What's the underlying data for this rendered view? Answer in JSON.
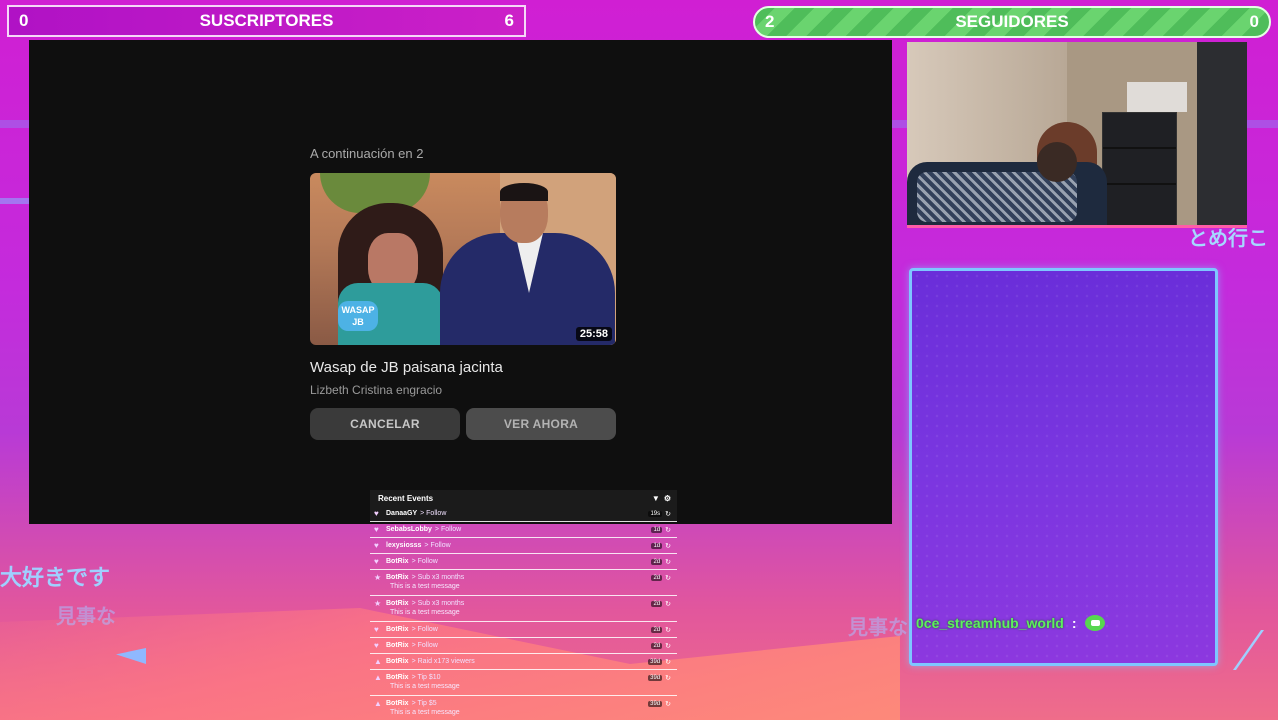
{
  "top_bars": {
    "subs": {
      "left_count": "0",
      "label": "SUSCRIPTORES",
      "right_count": "6"
    },
    "followers": {
      "left_count": "2",
      "label": "SEGUIDORES",
      "right_count": "0"
    }
  },
  "player": {
    "up_next_label": "A continuación en 2",
    "thumbnail_logo": "WASAP JB",
    "thumbnail_caption": "",
    "duration": "25:58",
    "video_title": "Wasap de JB paisana jacinta",
    "channel_name": "Lizbeth Cristina engracio",
    "cancel_label": "CANCELAR",
    "watch_label": "VER AHORA"
  },
  "decor_text": {
    "jp_left_1": "大好きです",
    "jp_left_2": "見事な",
    "jp_right_1": "とめ行こ",
    "jp_right_2": "見事な"
  },
  "chat": {
    "messages": [
      {
        "user": "0ce_streamhub_world",
        "separator": ":",
        "emote": "green-bubble-emote"
      }
    ]
  },
  "recent_events": {
    "title": "Recent Events",
    "rows": [
      {
        "icon": "♥",
        "name": "DanaaGY",
        "action": "> Follow",
        "time": "19s",
        "message": ""
      },
      {
        "icon": "♥",
        "name": "SebabsLobby",
        "action": "> Follow",
        "time": "1d",
        "message": ""
      },
      {
        "icon": "♥",
        "name": "lexysiosss",
        "action": "> Follow",
        "time": "1d",
        "message": ""
      },
      {
        "icon": "♥",
        "name": "BotRix",
        "action": "> Follow",
        "time": "2d",
        "message": ""
      },
      {
        "icon": "★",
        "name": "BotRix",
        "action": "> Sub x3 months",
        "time": "2d",
        "message": "This is a test message"
      },
      {
        "icon": "★",
        "name": "BotRix",
        "action": "> Sub x3 months",
        "time": "2d",
        "message": "This is a test message"
      },
      {
        "icon": "♥",
        "name": "BotRix",
        "action": "> Follow",
        "time": "2d",
        "message": ""
      },
      {
        "icon": "♥",
        "name": "BotRix",
        "action": "> Follow",
        "time": "2d",
        "message": ""
      },
      {
        "icon": "▲",
        "name": "BotRix",
        "action": "> Raid x173 viewers",
        "time": "39d",
        "message": ""
      },
      {
        "icon": "▲",
        "name": "BotRix",
        "action": "> Tip $10",
        "time": "39d",
        "message": "This is a test message"
      },
      {
        "icon": "▲",
        "name": "BotRix",
        "action": "> Tip $5",
        "time": "39d",
        "message": "This is a test message"
      }
    ]
  },
  "colors": {
    "subs_bar": "#b012c5",
    "followers_bar": "#4fbd5a",
    "chat_border": "#7ec6ff",
    "chat_username": "#5df05d"
  }
}
